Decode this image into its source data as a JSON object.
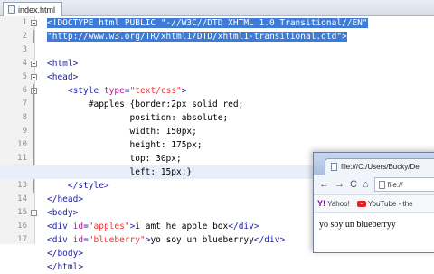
{
  "tab": {
    "label": "index.html"
  },
  "editor": {
    "line_numbers": [
      "1",
      "2",
      "3",
      "4",
      "5",
      "6",
      "7",
      "8",
      "9",
      "10",
      "11",
      "12",
      "13",
      "14",
      "15",
      "16",
      "17"
    ],
    "lines": [
      [
        [
          "sel",
          "<!DOCTYPE html PUBLIC \"-//W3C//DTD XHTML 1.0 Transitional//EN\""
        ]
      ],
      [
        [
          "sel",
          "\"http://www.w3.org/TR/xhtml1/DTD/xhtml1-transitional.dtd\">"
        ]
      ],
      [
        [
          "txt",
          ""
        ]
      ],
      [
        [
          "tag",
          "<html>"
        ]
      ],
      [
        [
          "tag",
          "<head>"
        ]
      ],
      [
        [
          "txt",
          "    "
        ],
        [
          "tag",
          "<style "
        ],
        [
          "attr",
          "type"
        ],
        [
          "tag",
          "="
        ],
        [
          "val",
          "\"text/css\""
        ],
        [
          "tag",
          ">"
        ]
      ],
      [
        [
          "txt",
          "        #apples {border:2px solid red;"
        ]
      ],
      [
        [
          "txt",
          "                position: absolute;"
        ]
      ],
      [
        [
          "txt",
          "                width: 150px;"
        ]
      ],
      [
        [
          "txt",
          "                height: 175px;"
        ]
      ],
      [
        [
          "txt",
          "                top: 30px;"
        ]
      ],
      [
        [
          "txt",
          "                left: 15px;}"
        ]
      ],
      [
        [
          "txt",
          "    "
        ],
        [
          "tag",
          "</style>"
        ]
      ],
      [
        [
          "tag",
          "</head>"
        ]
      ],
      [
        [
          "tag",
          "<body>"
        ]
      ],
      [
        [
          "tag",
          "<div "
        ],
        [
          "attr",
          "id"
        ],
        [
          "tag",
          "="
        ],
        [
          "val",
          "\"apples\""
        ],
        [
          "tag",
          ">"
        ],
        [
          "txt",
          "i amt he apple box"
        ],
        [
          "tag",
          "</div>"
        ]
      ],
      [
        [
          "tag",
          "<div "
        ],
        [
          "attr",
          "id"
        ],
        [
          "tag",
          "="
        ],
        [
          "val",
          "\"blueberry\""
        ],
        [
          "tag",
          ">"
        ],
        [
          "txt",
          "yo soy un blueberryy"
        ],
        [
          "tag",
          "</div>"
        ]
      ],
      [
        [
          "tag",
          "</body>"
        ]
      ],
      [
        [
          "tag",
          "</html>"
        ]
      ]
    ],
    "highlight_line": 12
  },
  "browser": {
    "tab_title": "file:///C:/Users/Bucky/De",
    "nav": {
      "back": "←",
      "forward": "→",
      "reload": "C",
      "home": "⌂"
    },
    "url": "file://",
    "bookmarks": [
      {
        "icon": "Y!",
        "label": "Yahoo!"
      },
      {
        "label": "YouTube - the"
      }
    ],
    "content": "yo soy un blueberryy"
  }
}
